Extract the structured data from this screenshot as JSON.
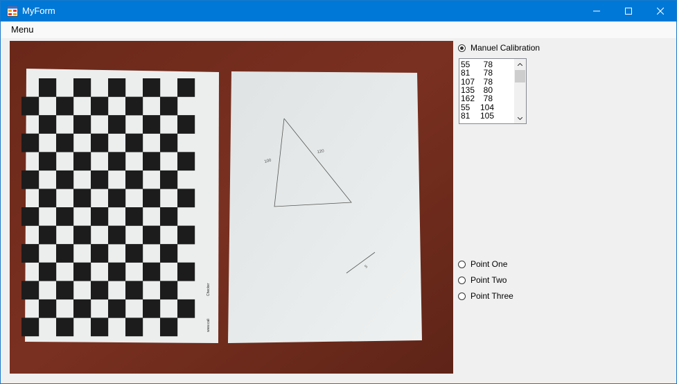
{
  "window": {
    "title": "MyForm"
  },
  "menu": {
    "label": "Menu"
  },
  "calibration": {
    "mode_label": "Manuel Calibration",
    "mode_selected": true,
    "list": [
      [
        "55",
        "78"
      ],
      [
        "81",
        "78"
      ],
      [
        "107",
        "78"
      ],
      [
        "135",
        "80"
      ],
      [
        "162",
        "78"
      ],
      [
        "55",
        "104"
      ],
      [
        "81",
        "105"
      ]
    ]
  },
  "points": [
    {
      "label": "Point One"
    },
    {
      "label": "Point Two"
    },
    {
      "label": "Point Three"
    }
  ],
  "photo": {
    "sheet_text": "Checker",
    "sheet_url_fragment": "www.cali",
    "triangle_labels": [
      "100",
      "120"
    ],
    "line_label": "5"
  },
  "colors": {
    "title_bar": "#0078d7",
    "table_surface": "#6e2a1c",
    "paper": "#e6eaea",
    "checker_dark": "#1c1c1c"
  },
  "icons": [
    "app-form-icon",
    "minimize-icon",
    "maximize-icon",
    "close-icon",
    "scroll-up-icon",
    "scroll-down-icon"
  ]
}
